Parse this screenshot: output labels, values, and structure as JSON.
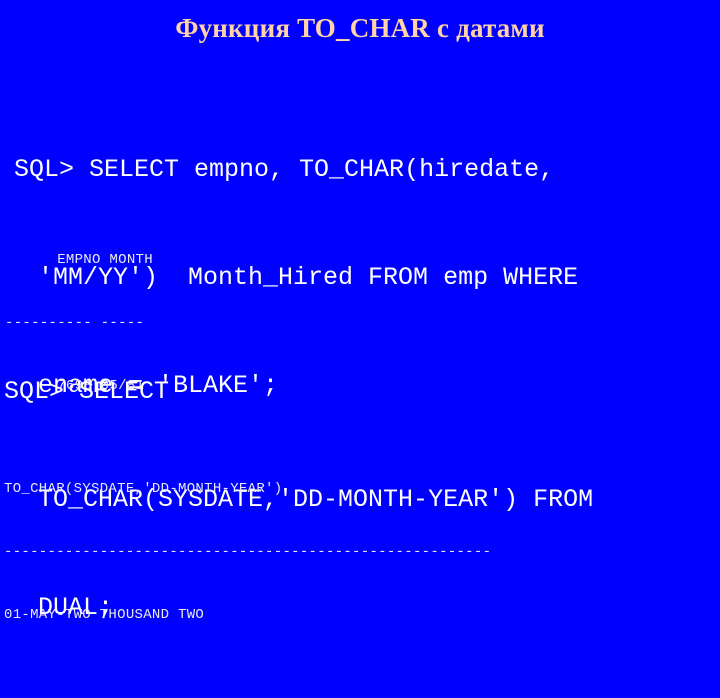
{
  "slide": {
    "title": "Функция TO_CHAR с датами",
    "background_color": "#0000FF",
    "title_color": "#FFD2A8",
    "code_color": "#FFFFFF",
    "output_color": "#E9E9F2"
  },
  "sql_block_1": {
    "line_1": "SQL> SELECT empno, TO_CHAR(hiredate,",
    "line_2": "'MM/YY')  Month_Hired FROM emp WHERE",
    "line_3": "ename = 'BLAKE';"
  },
  "output_block_1": {
    "header": "      EMPNO MONTH",
    "rule": "---------- -----",
    "row_1": "      7698 05/81"
  },
  "sql_block_2": {
    "line_1": "SQL> SELECT",
    "line_2": "TO_CHAR(SYSDATE,'DD-MONTH-YEAR') FROM",
    "line_3": "DUAL;"
  },
  "output_block_2": {
    "header": "TO_CHAR(SYSDATE,'DD-MONTH-YEAR')",
    "rule": "--------------------------------------------------------",
    "row_1": "01-MAY-TWO THOUSAND TWO"
  }
}
